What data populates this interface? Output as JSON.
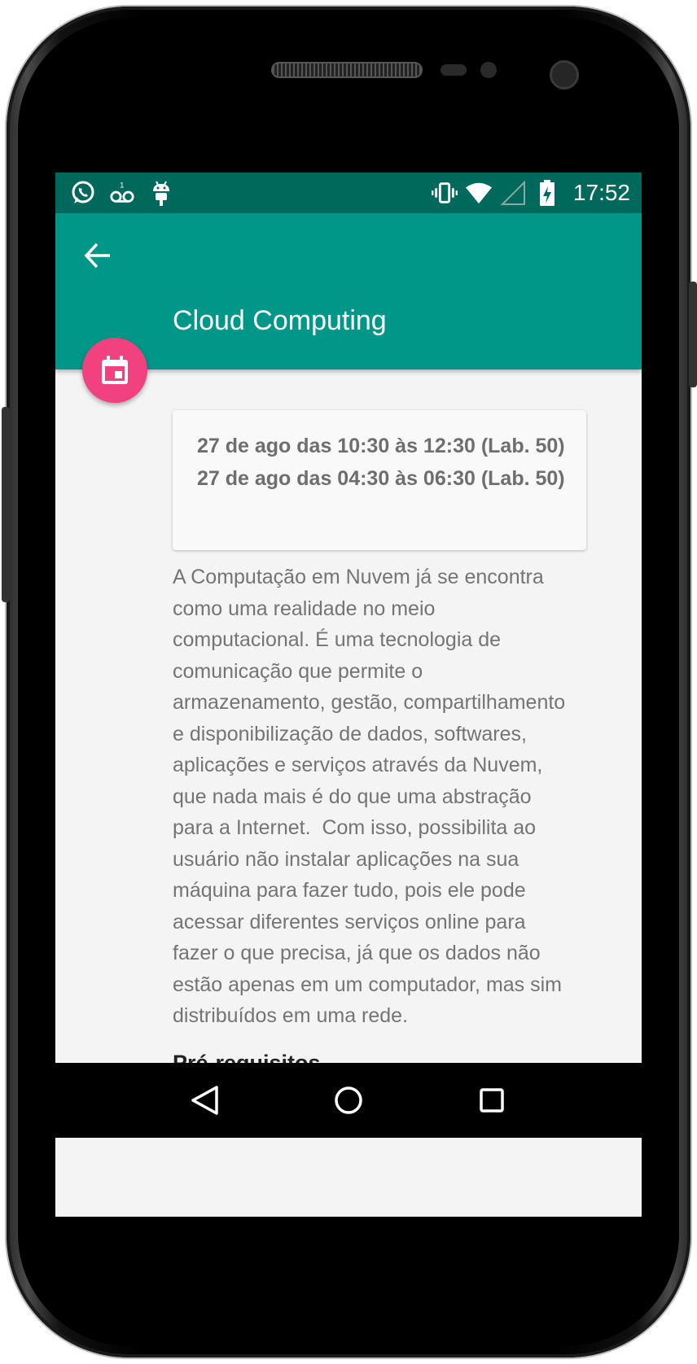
{
  "device": {
    "frame_color": "#000000"
  },
  "status_bar": {
    "time": "17:52",
    "color": "#00695c",
    "left_icons": [
      "whatsapp-icon",
      "voicemail-icon",
      "android-debug-icon"
    ],
    "right_icons": [
      "vibrate-icon",
      "wifi-icon",
      "cell-signal-icon",
      "battery-charging-icon"
    ]
  },
  "app_bar": {
    "title": "Cloud Computing",
    "color": "#009688",
    "back_icon": "arrow-back-icon"
  },
  "fab": {
    "icon": "calendar-icon",
    "color": "#f2417f"
  },
  "schedule": [
    "27 de ago das 10:30 às 12:30 (Lab. 50)",
    "27 de ago das 04:30 às 06:30 (Lab. 50)"
  ],
  "description_lines": [
    "A Computação em Nuvem já se encontra",
    "como uma realidade no meio",
    "computacional. É uma tecnologia de",
    "comunicação que permite o",
    "armazenamento, gestão, compartilhamento",
    "e disponibilização de dados, softwares,",
    "aplicações e serviços através da Nuvem,",
    "que nada mais é do que uma abstração",
    "para a Internet.  Com isso, possibilita ao",
    "usuário não instalar aplicações na sua",
    "máquina para fazer tudo, pois ele pode",
    "acessar diferentes serviços online para",
    "fazer o que precisa, já que os dados não",
    "estão apenas em um computador, mas sim",
    "distribuídos em uma rede."
  ],
  "section_heading": "Pré-requisitos",
  "nav_bar": {
    "buttons": [
      "back-triangle-icon",
      "home-circle-icon",
      "recents-square-icon"
    ]
  }
}
